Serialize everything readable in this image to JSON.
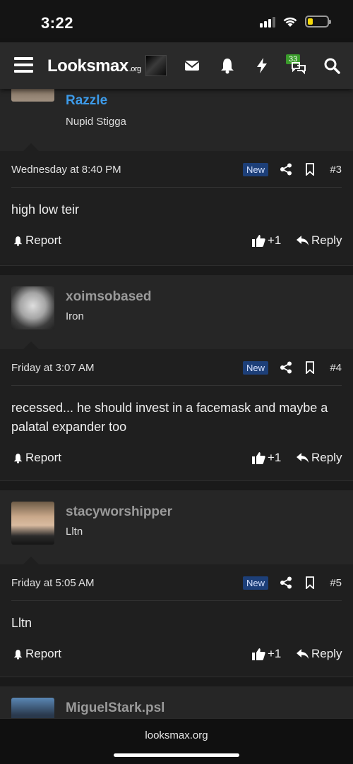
{
  "status": {
    "time": "3:22"
  },
  "nav": {
    "logo": "Looksmax",
    "logo_suffix": ".org",
    "conversations_count": "33"
  },
  "posts": [
    {
      "username": "Razzle",
      "username_color": "#3d9be9",
      "user_title": "Nupid Stigga",
      "date": "Wednesday at 8:40 PM",
      "badge": "New",
      "number": "#3",
      "message": "high low teir",
      "report": "Report",
      "likes": "+1",
      "reply": "Reply"
    },
    {
      "username": "xoimsobased",
      "username_color": "#9a9a9a",
      "user_title": "Iron",
      "date": "Friday at 3:07 AM",
      "badge": "New",
      "number": "#4",
      "message": "recessed... he should invest in a facemask and maybe a palatal expander too",
      "report": "Report",
      "likes": "+1",
      "reply": "Reply"
    },
    {
      "username": "stacyworshipper",
      "username_color": "#9a9a9a",
      "user_title": "Lltn",
      "date": "Friday at 5:05 AM",
      "badge": "New",
      "number": "#5",
      "message": "Lltn",
      "report": "Report",
      "likes": "+1",
      "reply": "Reply"
    },
    {
      "username": "MiguelStark.psl",
      "username_color": "#9a9a9a"
    }
  ],
  "browser": {
    "url": "looksmax.org"
  }
}
